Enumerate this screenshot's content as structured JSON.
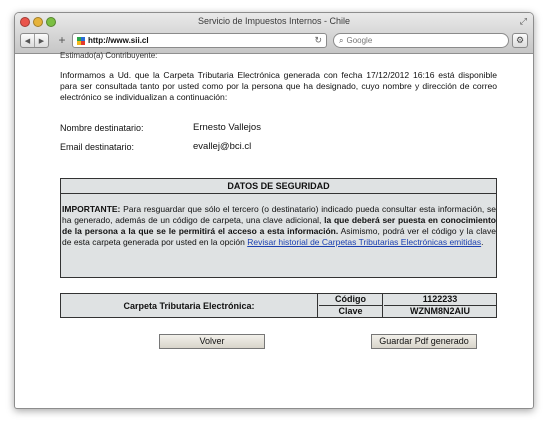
{
  "window": {
    "title": "Servicio de Impuestos Internos - Chile"
  },
  "toolbar": {
    "url": "http://www.sii.cl",
    "search_placeholder": "Google",
    "back_icon": "back-arrow-icon",
    "forward_icon": "forward-arrow-icon"
  },
  "page": {
    "greeting_cut": "Estimado(a) Contribuyente:",
    "intro": "Informamos a Ud. que la Carpeta Tributaria Electrónica generada con fecha 17/12/2012 16:16 está disponible para ser consultada tanto por usted como por la persona que ha designado, cuyo nombre y dirección de correo electrónico se individualizan a continuación:",
    "recipient_name_label": "Nombre destinatario:",
    "recipient_name_value": "Ernesto Vallejos",
    "recipient_email_label": "Email destinatario:",
    "recipient_email_value": "evallej@bci.cl",
    "security": {
      "heading": "DATOS DE SEGURIDAD",
      "important_label": "IMPORTANTE:",
      "text_part1": " Para resguardar que sólo el tercero (o destinatario) indicado pueda consultar esta información, se ha generado, además de un código de carpeta, una clave adicional, ",
      "text_bold": "la que deberá ser puesta en conocimiento de la persona a la que se le permitirá el acceso a esta información.",
      "text_part2": " Asimismo, podrá ver el código y la clave de esta carpeta generada por usted en la opción ",
      "link_text": "Revisar historial de Carpetas Tributarias Electrónicas emitidas",
      "text_end": "."
    },
    "folder": {
      "label": "Carpeta Tributaria Electrónica:",
      "code_label": "Código",
      "code_value": "1122233",
      "key_label": "Clave",
      "key_value": "WZNM8N2AIU"
    },
    "buttons": {
      "back": "Volver",
      "save_pdf": "Guardar Pdf generado"
    }
  },
  "colors": {
    "panel_bg": "#dfe2e3",
    "link": "#1a3fb0",
    "button_bg": "#d8d4ca"
  }
}
